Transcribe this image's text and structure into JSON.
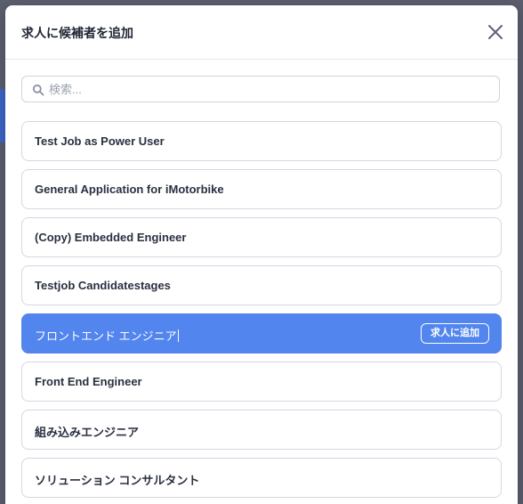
{
  "modal": {
    "title": "求人に候補者を追加"
  },
  "search": {
    "placeholder": "検索...",
    "value": ""
  },
  "jobs": [
    {
      "label": "Test Job as Power User",
      "selected": false
    },
    {
      "label": "General Application for iMotorbike",
      "selected": false
    },
    {
      "label": "(Copy) Embedded Engineer",
      "selected": false
    },
    {
      "label": "Testjob Candidatestages",
      "selected": false
    },
    {
      "label": "フロントエンド エンジニア",
      "selected": true,
      "action_label": "求人に追加"
    },
    {
      "label": "Front End Engineer",
      "selected": false
    },
    {
      "label": "組み込みエンジニア",
      "selected": false
    },
    {
      "label": "ソリューション コンサルタント",
      "selected": false
    }
  ],
  "colors": {
    "accent": "#5285ed",
    "border": "#d3d8e0",
    "text": "#2a3040"
  },
  "icons": {
    "close": "close-icon",
    "search": "search-icon"
  }
}
